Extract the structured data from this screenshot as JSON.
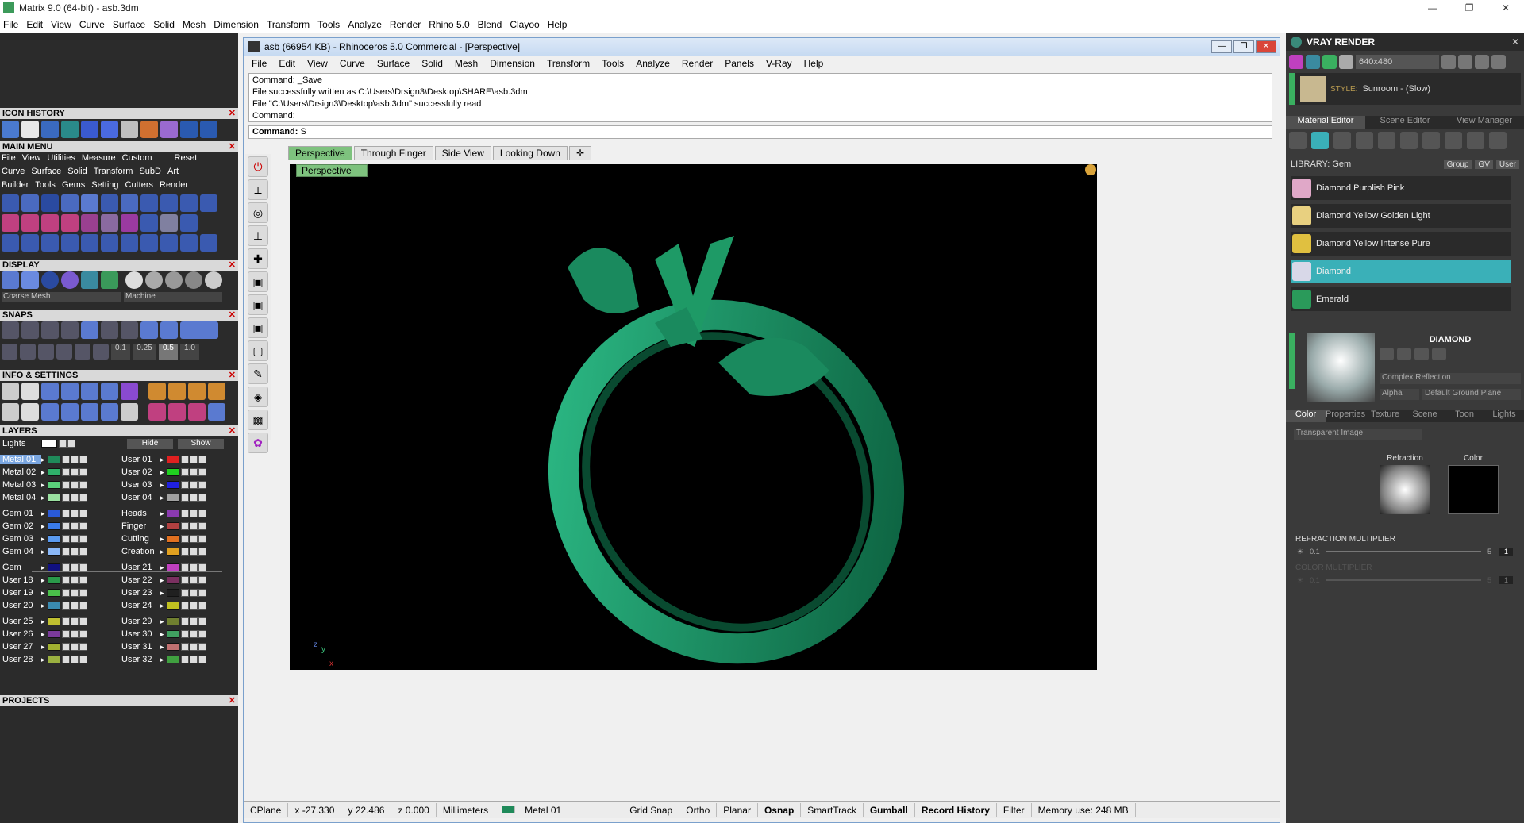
{
  "app": {
    "title": "Matrix 9.0 (64-bit) - asb.3dm",
    "window_buttons": [
      "—",
      "❐",
      "✕"
    ],
    "menu": [
      "File",
      "Edit",
      "View",
      "Curve",
      "Surface",
      "Solid",
      "Mesh",
      "Dimension",
      "Transform",
      "Tools",
      "Analyze",
      "Render",
      "Rhino 5.0",
      "Blend",
      "Clayoo",
      "Help"
    ]
  },
  "left": {
    "icon_history": "ICON HISTORY",
    "main_menu": "MAIN MENU",
    "mm_row1": [
      "File",
      "View",
      "Utilities",
      "Measure",
      "Custom",
      "Reset"
    ],
    "mm_row2": [
      "Curve",
      "Surface",
      "Solid",
      "Transform",
      "SubD",
      "Art"
    ],
    "mm_row3": [
      "Builder",
      "Tools",
      "Gems",
      "Setting",
      "Cutters",
      "Render"
    ],
    "display": "DISPLAY",
    "display_mode": "Coarse Mesh",
    "display_style": "Machine",
    "snaps": "SNAPS",
    "snap_values": [
      "0.1",
      "0.25",
      "0.5",
      "1.0"
    ],
    "info_settings": "INFO & SETTINGS",
    "layers": "LAYERS",
    "lights": "Lights",
    "hide": "Hide",
    "show": "Show",
    "layers_left": [
      {
        "name": "Metal 01",
        "color": "#1f8a5a",
        "selected": true
      },
      {
        "name": "Metal 02",
        "color": "#2fb06a"
      },
      {
        "name": "Metal 03",
        "color": "#5ad07a"
      },
      {
        "name": "Metal 04",
        "color": "#9ae0a0"
      },
      {
        "name": "Gem 01",
        "color": "#2a5ad8"
      },
      {
        "name": "Gem 02",
        "color": "#3a7ae8"
      },
      {
        "name": "Gem 03",
        "color": "#5a9af0"
      },
      {
        "name": "Gem 04",
        "color": "#8ab8f8"
      },
      {
        "name": "Gem",
        "color": "#101080"
      },
      {
        "name": "User 18",
        "color": "#2a9a4a"
      },
      {
        "name": "User 19",
        "color": "#4ac04a"
      },
      {
        "name": "User 20",
        "color": "#3a8ab0"
      },
      {
        "name": "User 25",
        "color": "#c0c030"
      },
      {
        "name": "User 26",
        "color": "#7a3a9a"
      },
      {
        "name": "User 27",
        "color": "#a0b030"
      },
      {
        "name": "User 28",
        "color": "#9ab040"
      }
    ],
    "layers_right": [
      {
        "name": "User 01",
        "color": "#e02020"
      },
      {
        "name": "User 02",
        "color": "#20d020"
      },
      {
        "name": "User 03",
        "color": "#2020e0"
      },
      {
        "name": "User 04",
        "color": "#a0a0a0"
      },
      {
        "name": "Heads",
        "color": "#8a3ab0"
      },
      {
        "name": "Finger",
        "color": "#b04040"
      },
      {
        "name": "Cutting",
        "color": "#e07020"
      },
      {
        "name": "Creation",
        "color": "#e0a020"
      },
      {
        "name": "User 21",
        "color": "#c040c0"
      },
      {
        "name": "User 22",
        "color": "#7a3060"
      },
      {
        "name": "User 23",
        "color": "#202020"
      },
      {
        "name": "User 24",
        "color": "#c0c020"
      },
      {
        "name": "User 29",
        "color": "#708030"
      },
      {
        "name": "User 30",
        "color": "#40a060"
      },
      {
        "name": "User 31",
        "color": "#c07070"
      },
      {
        "name": "User 32",
        "color": "#40a040"
      }
    ],
    "projects": "PROJECTS"
  },
  "rhino": {
    "title": "asb (66954 KB) - Rhinoceros 5.0 Commercial - [Perspective]",
    "menu": [
      "File",
      "Edit",
      "View",
      "Curve",
      "Surface",
      "Solid",
      "Mesh",
      "Dimension",
      "Transform",
      "Tools",
      "Analyze",
      "Render",
      "Panels",
      "V-Ray",
      "Help"
    ],
    "history": [
      "Command: _Save",
      "File successfully written as C:\\Users\\Drsign3\\Desktop\\SHARE\\asb.3dm",
      "File \"C:\\Users\\Drsign3\\Desktop\\asb.3dm\" successfully read",
      "Command:"
    ],
    "command_label": "Command:",
    "command_value": "S",
    "tabs": [
      "Perspective",
      "Through Finger",
      "Side View",
      "Looking Down"
    ],
    "viewport_label": "Perspective",
    "axis_labels": [
      "z",
      "y",
      "x"
    ],
    "status": {
      "cplane": "CPlane",
      "x": "x -27.330",
      "y": "y 22.486",
      "z": "z 0.000",
      "units": "Millimeters",
      "layer": "Metal 01",
      "grid_snap": "Grid Snap",
      "ortho": "Ortho",
      "planar": "Planar",
      "osnap": "Osnap",
      "smarttrack": "SmartTrack",
      "gumball": "Gumball",
      "record_history": "Record History",
      "filter": "Filter",
      "memory": "Memory use: 248 MB"
    }
  },
  "vray": {
    "title": "VRAY RENDER",
    "resolution": "640x480",
    "style_label": "STYLE:",
    "style_value": "Sunroom - (Slow)",
    "tabs": [
      "Material Editor",
      "Scene Editor",
      "View Manager"
    ],
    "library_label": "LIBRARY: Gem",
    "group_btn": "Group",
    "gv_btn": "GV",
    "user_btn": "User",
    "materials": [
      {
        "name": "Diamond Purplish Pink",
        "color": "#e0a8c8"
      },
      {
        "name": "Diamond Yellow Golden Light",
        "color": "#e8d080"
      },
      {
        "name": "Diamond Yellow Intense Pure",
        "color": "#e0c040"
      },
      {
        "name": "Diamond",
        "color": "#d8d8e8",
        "selected": true
      },
      {
        "name": "Emerald",
        "color": "#2a9a5a"
      }
    ],
    "material_name": "DIAMOND",
    "shader": "Complex Reflection",
    "alpha": "Alpha",
    "ground": "Default Ground Plane",
    "prop_tabs": [
      "Color",
      "Properties",
      "Texture",
      "Scene",
      "Toon",
      "Lights"
    ],
    "transparent": "Transparent Image",
    "refraction": "Refraction",
    "color": "Color",
    "refraction_multiplier": "REFRACTION MULTIPLIER",
    "color_multiplier": "COLOR MULTIPLIER",
    "rm_min": "0.1",
    "rm_max": "5",
    "rm_value": "1",
    "cm_min": "0.1",
    "cm_max": "5",
    "cm_value": "1"
  }
}
